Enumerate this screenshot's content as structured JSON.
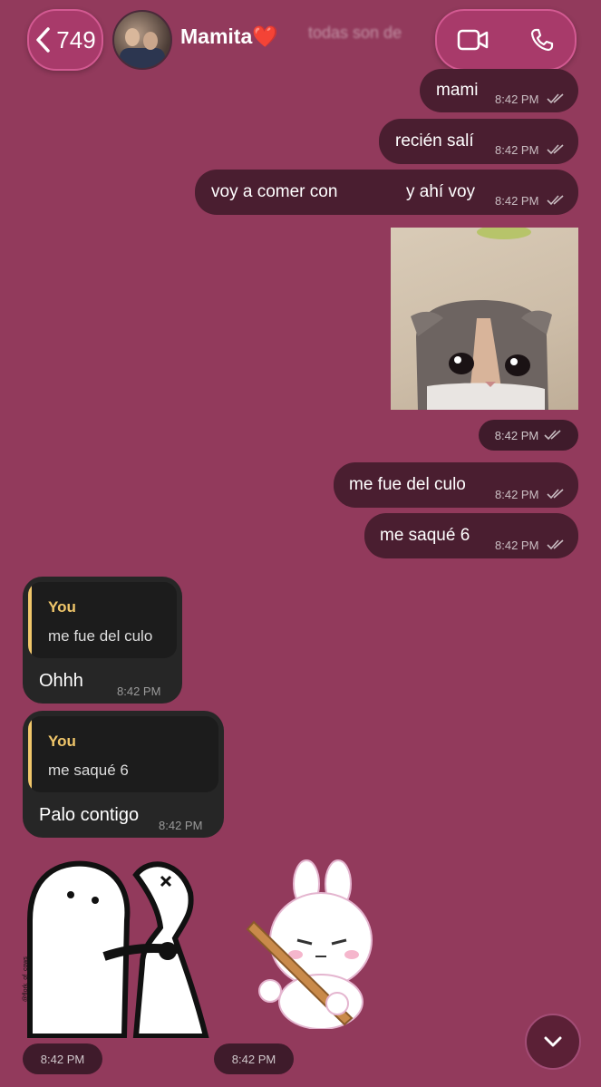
{
  "header": {
    "back_count": "749",
    "contact_name": "Mamita❤️",
    "preview_text": "todas son de"
  },
  "messages_out": [
    {
      "text": "mami",
      "time": "8:42 PM"
    },
    {
      "text": "recién salí",
      "time": "8:42 PM"
    },
    {
      "text_a": "voy a comer con",
      "text_b": "y ahí voy",
      "time": "8:42 PM"
    },
    {
      "time": "8:42 PM"
    },
    {
      "text": "me fue del culo",
      "time": "8:42 PM"
    },
    {
      "text": "me saqué 6",
      "time": "8:42 PM"
    }
  ],
  "messages_in": [
    {
      "quote_author": "You",
      "quote_text": "me fue del culo",
      "text": "Ohhh",
      "time": "8:42 PM"
    },
    {
      "quote_author": "You",
      "quote_text": "me saqué 6",
      "text": "Palo contigo",
      "time": "8:42 PM"
    }
  ],
  "stickers": [
    {
      "time": "8:42 PM",
      "caption": "@flork_of_cows"
    },
    {
      "time": "8:42 PM"
    }
  ],
  "colors": {
    "background": "#923a5c",
    "outgoing_bubble": "#4a1e30",
    "incoming_bubble": "#262626",
    "reply_accent": "#f0c66a"
  }
}
